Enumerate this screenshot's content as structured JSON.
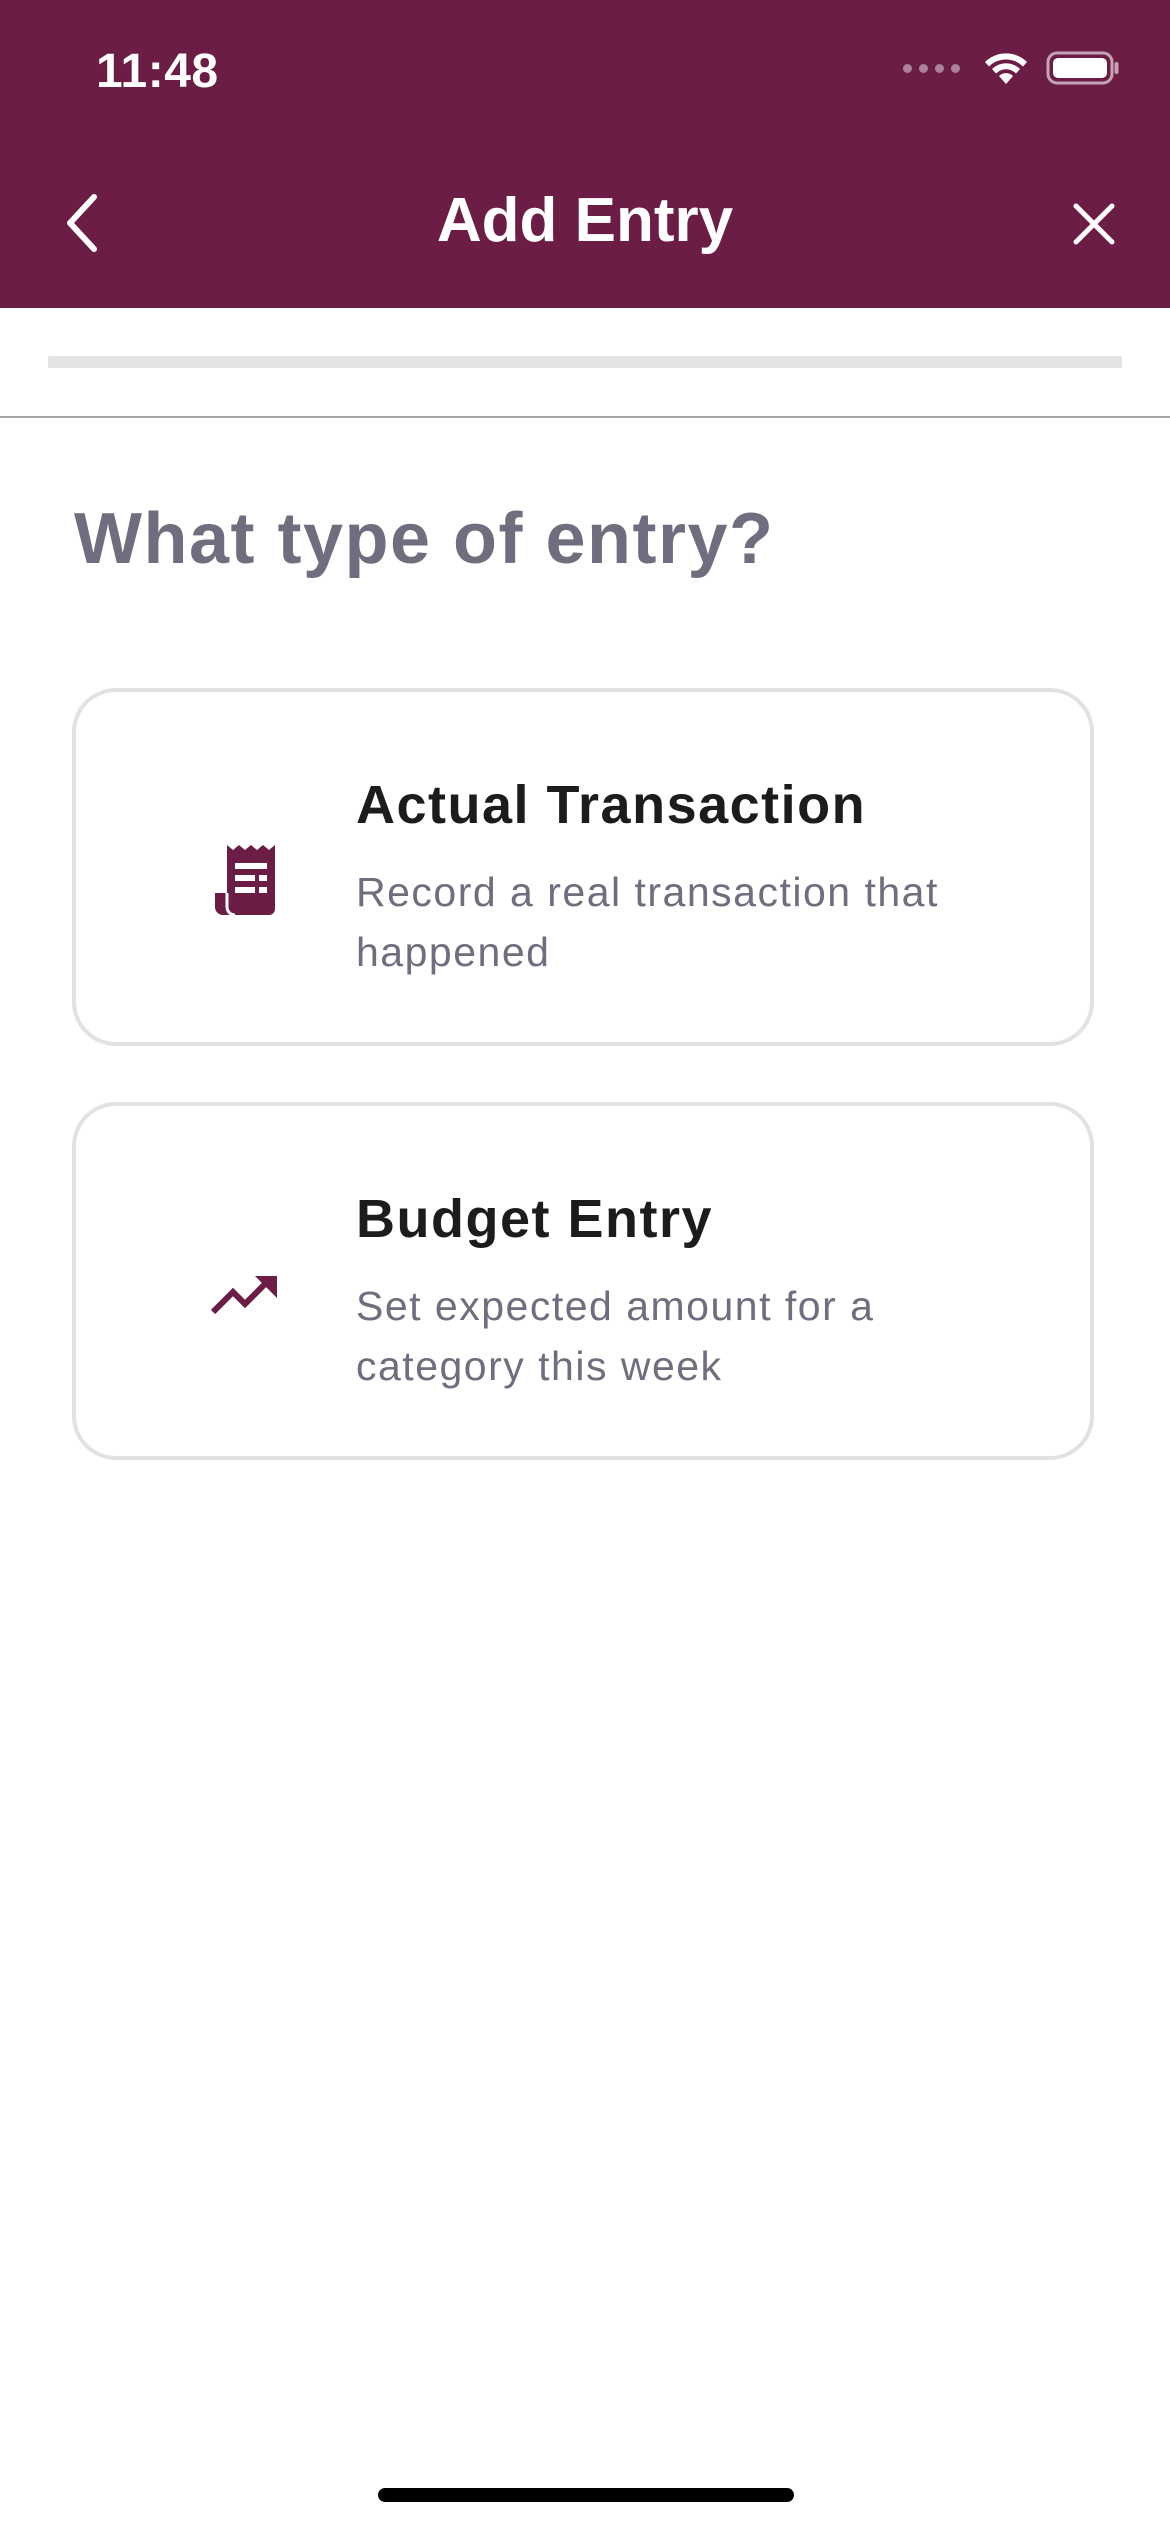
{
  "status_bar": {
    "time": "11:48"
  },
  "nav": {
    "title": "Add Entry",
    "back_icon": "chevron-left-icon",
    "close_icon": "close-icon"
  },
  "progress": {
    "fraction": 0
  },
  "question": "What type of entry?",
  "options": [
    {
      "title": "Actual Transaction",
      "subtitle": "Record a real transaction that happened",
      "icon": "receipt-icon"
    },
    {
      "title": "Budget Entry",
      "subtitle": "Set expected amount for a category this week",
      "icon": "trending-up-icon"
    }
  ],
  "colors": {
    "brand": "#6b1d45",
    "text_primary": "#1c1c1e",
    "text_secondary": "#6e6e7e",
    "card_border": "#e2e2e2"
  }
}
